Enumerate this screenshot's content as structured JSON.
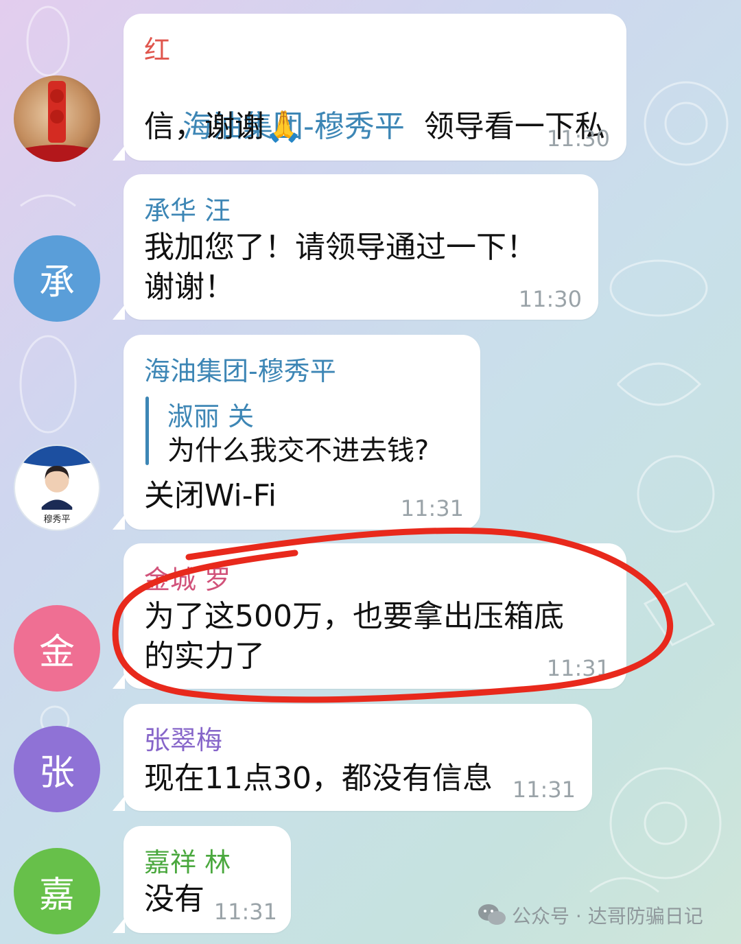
{
  "messages": [
    {
      "avatar_text": "",
      "sender": "红",
      "inline_mention": "海油集团-穆秀平",
      "text_line1_rest": "  领导看一下私",
      "text_line2": "信，谢谢🙏",
      "time": "11:30"
    },
    {
      "avatar_text": "承",
      "sender": "承华 汪",
      "text": "我加您了！请领导通过一下！\n谢谢！",
      "time": "11:30"
    },
    {
      "avatar_text": "",
      "avatar_caption": "穆秀平",
      "sender": "海油集团-穆秀平",
      "reply_sender": "淑丽 关",
      "reply_text": "为什么我交不进去钱?",
      "text": "关闭Wi-Fi",
      "time": "11:31"
    },
    {
      "avatar_text": "金",
      "sender": "金城 罗",
      "text": "为了这500万，也要拿出压箱底\n的实力了",
      "time": "11:31"
    },
    {
      "avatar_text": "张",
      "sender": "张翠梅",
      "text": "现在11点30，都没有信息",
      "time": "11:31"
    },
    {
      "avatar_text": "嘉",
      "sender": "嘉祥 林",
      "text": "没有",
      "time": "11:31"
    }
  ],
  "colors": {
    "sender_red": "#e0564d",
    "sender_blue": "#3d86b5",
    "sender_pink": "#d1527a",
    "sender_purple": "#8665c9",
    "sender_green": "#4aa83e",
    "avatar_blue": "#5a9ed9",
    "avatar_pink": "#ef6f93",
    "avatar_purple": "#8f72d6",
    "avatar_green": "#67c04a",
    "annotation_red": "#e8291c"
  },
  "watermark": {
    "icon": "wechat-icon",
    "text": "公众号 · 达哥防骗日记"
  }
}
